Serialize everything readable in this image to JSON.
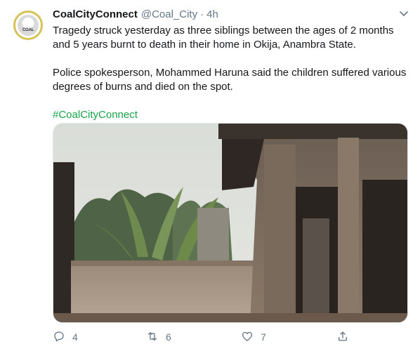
{
  "tweet": {
    "author_name": "CoalCityConnect",
    "handle": "@Coal_City",
    "separator": "·",
    "time": "4h",
    "avatar_text": "COAL",
    "paragraphs": [
      "Tragedy struck yesterday as three siblings between the ages of 2 months and 5 years burnt to death in their home in Okija, Anambra State.",
      "Police spokesperson, Mohammed Haruna said the children suffered various degrees of burns and died on the spot."
    ],
    "hashtag": "#CoalCityConnect",
    "actions": {
      "reply_count": "4",
      "retweet_count": "6",
      "like_count": "7"
    }
  },
  "icons": [
    "chevron-down-icon",
    "reply-icon",
    "retweet-icon",
    "like-icon",
    "share-icon"
  ],
  "colors": {
    "text": "#14171a",
    "secondary": "#657786",
    "hashtag": "#17a34a",
    "avatar_ring": "#d8c25a"
  }
}
